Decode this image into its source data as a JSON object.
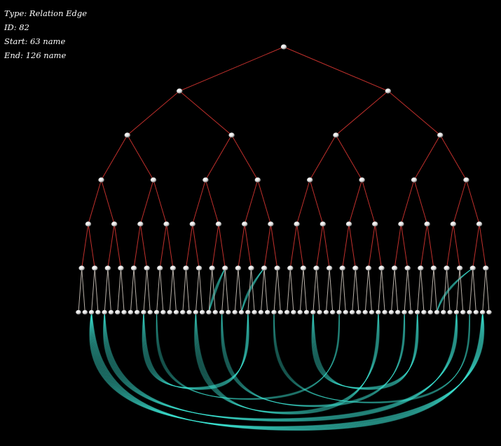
{
  "info_panel": {
    "type_line": "Type: Relation Edge",
    "id_line": "ID: 82",
    "start_line": "Start: 63 name",
    "end_line": "End: 126 name"
  },
  "tree": {
    "depth": 6,
    "edge_color": "#c0302c",
    "leaf_edge_color": "#b8b0a8",
    "node_color": "#ffffff",
    "relation_color": "#40e8d8"
  }
}
